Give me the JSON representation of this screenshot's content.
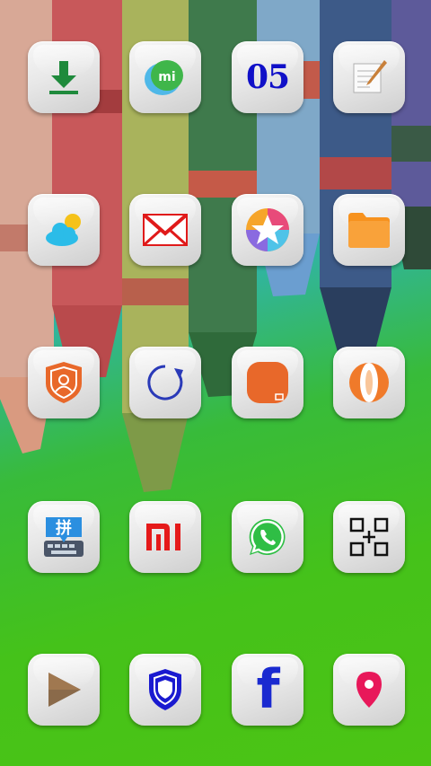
{
  "screen": {
    "type": "home-screen"
  },
  "apps": [
    {
      "icon": "download-arrow-icon"
    },
    {
      "icon": "mi-chat-bubble-icon",
      "label_text": "mi"
    },
    {
      "icon": "calendar-date-icon",
      "label_text": "05"
    },
    {
      "icon": "notepad-pencil-icon"
    },
    {
      "icon": "weather-sun-cloud-icon"
    },
    {
      "icon": "envelope-mail-icon"
    },
    {
      "icon": "star-gallery-icon"
    },
    {
      "icon": "folder-file-manager-icon"
    },
    {
      "icon": "security-shield-person-icon"
    },
    {
      "icon": "circular-arrow-refresh-icon"
    },
    {
      "icon": "orange-rounded-square-icon"
    },
    {
      "icon": "orange-browser-globe-icon"
    },
    {
      "icon": "pinyin-keyboard-icon",
      "label_text": "拼"
    },
    {
      "icon": "mi-logo-icon"
    },
    {
      "icon": "whatsapp-phone-icon"
    },
    {
      "icon": "qr-scanner-icon"
    },
    {
      "icon": "play-triangle-icon"
    },
    {
      "icon": "shield-blue-icon"
    },
    {
      "icon": "facebook-f-icon",
      "label_text": "f"
    },
    {
      "icon": "map-location-pin-icon"
    }
  ]
}
